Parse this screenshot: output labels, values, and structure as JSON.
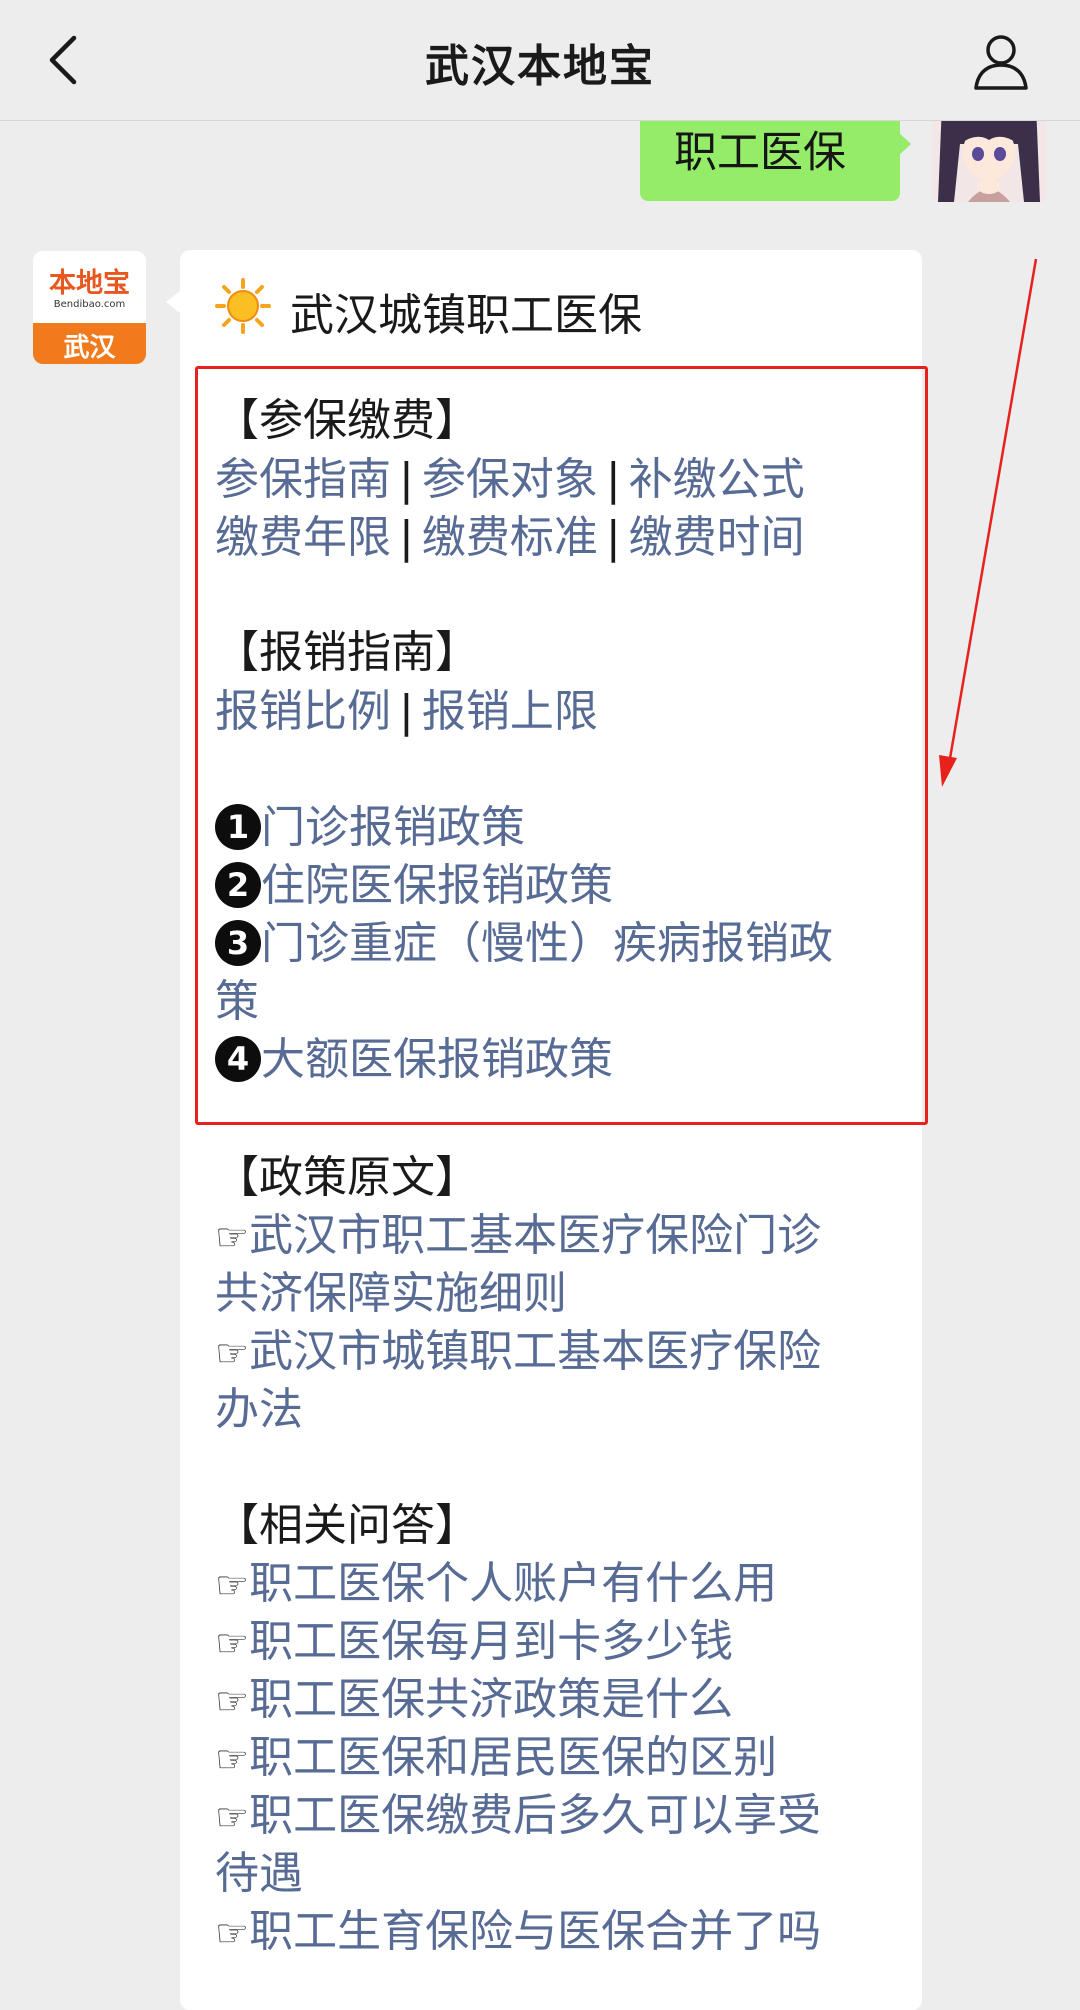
{
  "header": {
    "title": "武汉本地宝"
  },
  "sent_message": {
    "text": "职工医保"
  },
  "bot_avatar": {
    "logo_text": "本地宝",
    "logo_url": "Bendibao.com",
    "city": "武汉"
  },
  "reply": {
    "heading": "武汉城镇职工医保",
    "sections": {
      "payment": {
        "title": "【参保缴费】",
        "row1": [
          "参保指南",
          "参保对象",
          "补缴公式"
        ],
        "row2": [
          "缴费年限",
          "缴费标准",
          "缴费时间"
        ]
      },
      "reimburse": {
        "title": "【报销指南】",
        "row1": [
          "报销比例",
          "报销上限"
        ],
        "numbered": [
          {
            "num": "1",
            "text": "门诊报销政策"
          },
          {
            "num": "2",
            "text": "住院医保报销政策"
          },
          {
            "num": "3",
            "text": "门诊重症（慢性）疾病报销政",
            "wrap": "策"
          },
          {
            "num": "4",
            "text": "大额医保报销政策"
          }
        ]
      },
      "policy": {
        "title": "【政策原文】",
        "items": [
          {
            "line1": "武汉市职工基本医疗保险门诊",
            "line2": "共济保障实施细则"
          },
          {
            "line1": "武汉市城镇职工基本医疗保险",
            "line2": "办法"
          }
        ]
      },
      "qa": {
        "title": "【相关问答】",
        "items": [
          {
            "line1": "职工医保个人账户有什么用"
          },
          {
            "line1": "职工医保每月到卡多少钱"
          },
          {
            "line1": "职工医保共济政策是什么"
          },
          {
            "line1": "职工医保和居民医保的区别"
          },
          {
            "line1": "职工医保缴费后多久可以享受",
            "line2": "待遇"
          },
          {
            "line1": "职工生育保险与医保合并了吗"
          }
        ]
      }
    },
    "separator": "|",
    "pointer": "☞"
  },
  "colors": {
    "link": "#576b95",
    "sent_bubble": "#95ec69",
    "highlight_box": "#e8211c",
    "background": "#ededed"
  },
  "icons": [
    "back-chevron-icon",
    "user-profile-icon",
    "sun-icon",
    "pointing-hand-icon"
  ]
}
